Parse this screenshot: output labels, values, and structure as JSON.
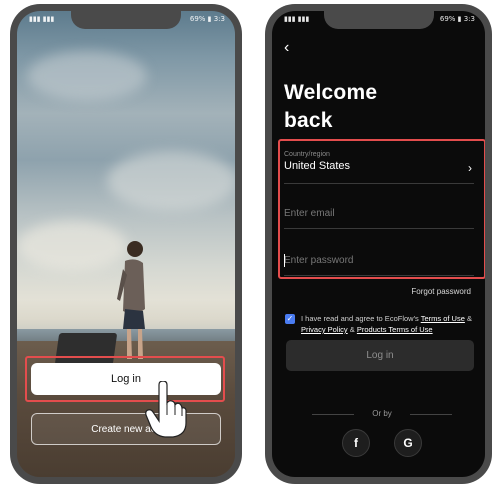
{
  "left": {
    "status_left": "▮▮▮ ▮▮▮",
    "status_right": "69% ▮ 3:3",
    "login_label": "Log in",
    "create_label": "Create new acc"
  },
  "right": {
    "status_left": "▮▮▮ ▮▮▮",
    "status_right": "69% ▮ 3:3",
    "back": "‹",
    "title_line1": "Welcome",
    "title_line2": "back",
    "country_label": "Country/region",
    "country_value": "United States",
    "email_placeholder": "Enter email",
    "password_placeholder": "Enter password",
    "forgot": "Forgot password",
    "terms_prefix": "I have read and agree to EcoFlow's ",
    "terms_of_use": "Terms of Use",
    "terms_and1": " & ",
    "privacy_policy": "Privacy Policy",
    "terms_and2": " & ",
    "products_terms": "Products Terms of Use",
    "login_label": "Log in",
    "or_by": "Or by",
    "facebook": "f",
    "google": "G"
  },
  "colors": {
    "highlight": "#e34d4d",
    "checkbox": "#4a7cf2",
    "dark_bg": "#0b0b0b"
  }
}
